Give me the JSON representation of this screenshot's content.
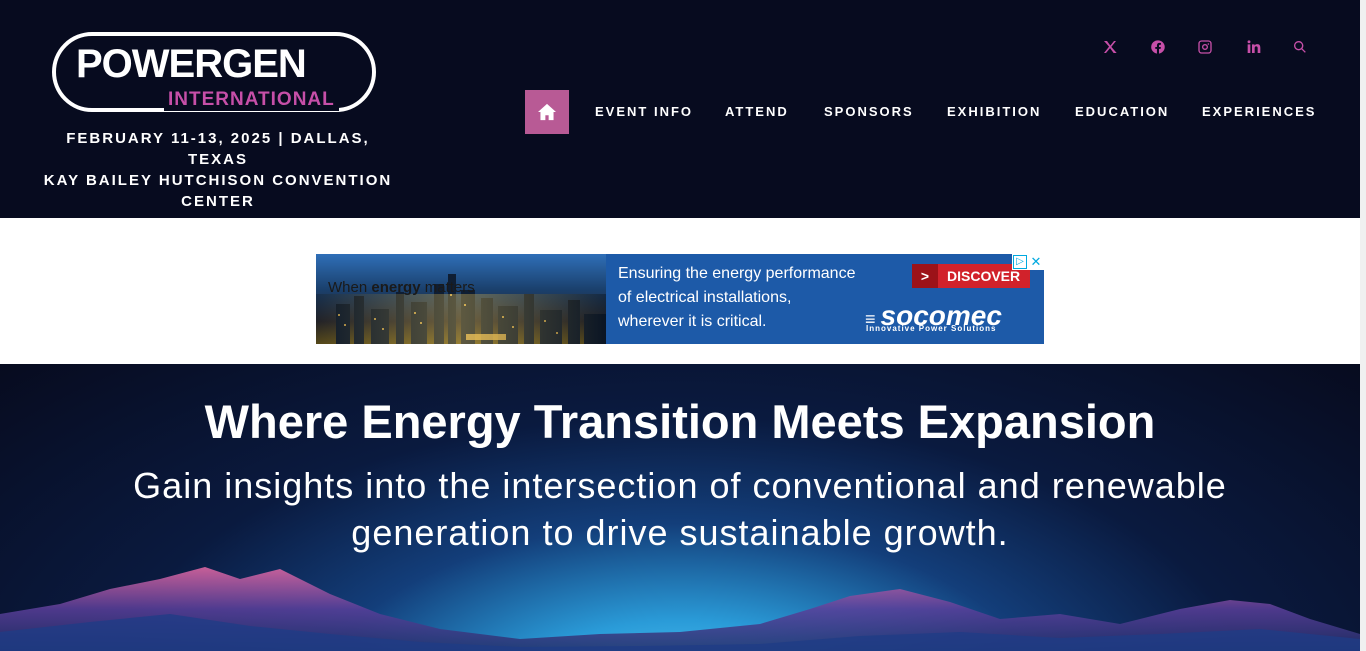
{
  "header": {
    "logo": {
      "main": "POWERGEN",
      "sub": "INTERNATIONAL"
    },
    "event": {
      "line1": "FEBRUARY 11-13, 2025 | DALLAS, TEXAS",
      "line2": "KAY BAILEY HUTCHISON CONVENTION CENTER"
    },
    "social": [
      "x-icon",
      "facebook-icon",
      "instagram-icon",
      "linkedin-icon",
      "search-icon"
    ],
    "nav": [
      "EVENT INFO",
      "ATTEND",
      "SPONSORS",
      "EXHIBITION",
      "EDUCATION",
      "EXPERIENCES"
    ],
    "accent": "#b85a95",
    "background": "#070b1f"
  },
  "ad": {
    "tagline_prefix": "When ",
    "tagline_bold": "energy",
    "tagline_suffix": " matters",
    "text": [
      "Ensuring the energy performance",
      "of electrical installations,",
      "wherever it is critical."
    ],
    "cta_arrow": ">",
    "cta": "DISCOVER",
    "brand": "socomec",
    "brand_sub": "Innovative Power Solutions",
    "adchoices": "▷",
    "close": "✕"
  },
  "hero": {
    "title": "Where Energy Transition Meets Expansion",
    "subtitle": "Gain insights into the intersection of conventional and renewable generation to drive sustainable growth."
  }
}
